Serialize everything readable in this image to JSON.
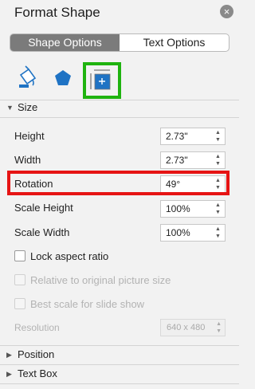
{
  "panel": {
    "title": "Format Shape"
  },
  "tabs": {
    "shape_options": "Shape Options",
    "text_options": "Text Options"
  },
  "icons": [
    "fill-line-icon",
    "effects-icon",
    "size-properties-icon"
  ],
  "size_section": {
    "label": "Size",
    "height": {
      "label": "Height",
      "value": "2.73\""
    },
    "width": {
      "label": "Width",
      "value": "2.73\""
    },
    "rotation": {
      "label": "Rotation",
      "value": "49°"
    },
    "scale_height": {
      "label": "Scale Height",
      "value": "100%"
    },
    "scale_width": {
      "label": "Scale Width",
      "value": "100%"
    },
    "lock_aspect": "Lock aspect ratio",
    "relative_original": "Relative to original picture size",
    "best_scale": "Best scale for slide show",
    "resolution": {
      "label": "Resolution",
      "value": "640 x 480"
    }
  },
  "sections": {
    "position": "Position",
    "text_box": "Text Box"
  },
  "colors": {
    "highlight_green": "#1fb30f",
    "highlight_red": "#e61414"
  }
}
